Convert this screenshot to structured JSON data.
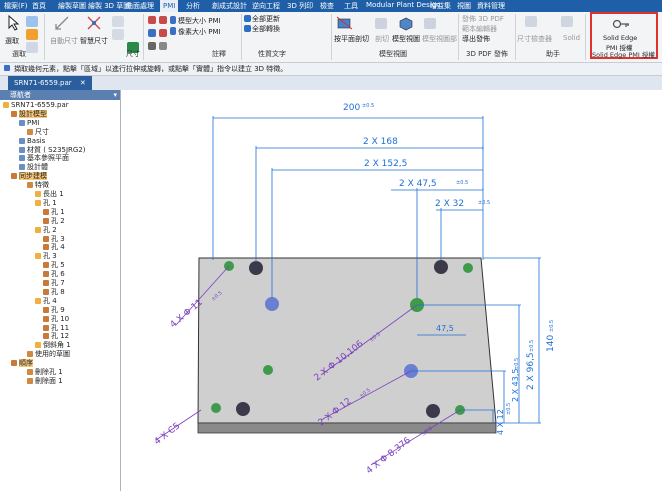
{
  "menu": {
    "items": [
      "檔案(F)",
      "首頁",
      "繪製草圖",
      "繪製 3D 草圖",
      "曲面處理",
      "PMI",
      "分析",
      "創成式設計",
      "逆向工程",
      "3D 列印",
      "檢查",
      "工具",
      "Modular Plant Design",
      "增益集",
      "視圖",
      "資料管理"
    ],
    "active": "PMI"
  },
  "ribbon": {
    "select_label": "選取",
    "auto_dim_label": "自動尺寸",
    "smart_dim_label": "智慧尺寸",
    "dim_group": "尺寸",
    "select_group": "選取",
    "model_size_pmi": "模型大小 PMI",
    "pixel_size_pmi": "像素大小 PMI",
    "annotate_group": "註釋",
    "update_all": "全部更新",
    "convert_all": "全部轉換",
    "props_group": "性質文字",
    "section_btn": "按平面剖切",
    "section_short": "剖切",
    "model_view_btn": "模型視圖",
    "model_view_sub": "模型視圖部",
    "model_view_group": "模型視圖",
    "publish_3dpdf": "發佈 3D PDF",
    "template_edit": "範本編輯器",
    "export_publish": "導出發佈",
    "pdf_group": "3D PDF 發佈",
    "dim_check": "尺寸檢查器",
    "solid_label": "Solid",
    "assistant_group": "助手",
    "se_pmi_line1": "Solid Edge",
    "se_pmi_line2": "PMI 授權",
    "se_pmi_group": "Solid Edge PMI 授權"
  },
  "prompt": "擷取幾何元素，點擊「區域」以進行拉伸或旋轉，或點擊「實體」指令以建立 3D 特徵。",
  "document_tab": "SRN71-6559.par",
  "navigator": {
    "title": "導航者",
    "items": [
      {
        "label": "SRN71-6559.par",
        "indent": 0,
        "hl": false
      },
      {
        "label": "設計模型",
        "indent": 1,
        "hl": true
      },
      {
        "label": "PMI",
        "indent": 2,
        "hl": false
      },
      {
        "label": "尺寸",
        "indent": 3,
        "hl": false
      },
      {
        "label": "Basis",
        "indent": 2,
        "hl": false
      },
      {
        "label": "材質 ( S235JRG2)",
        "indent": 2,
        "hl": false
      },
      {
        "label": "基本參照平面",
        "indent": 2,
        "hl": false
      },
      {
        "label": "設計體",
        "indent": 2,
        "hl": false
      },
      {
        "label": "同步建模",
        "indent": 1,
        "hl": true
      },
      {
        "label": "特徵",
        "indent": 3,
        "hl": false
      },
      {
        "label": "長出 1",
        "indent": 4,
        "hl": false
      },
      {
        "label": "孔 1",
        "indent": 4,
        "hl": false
      },
      {
        "label": "孔 1",
        "indent": 5,
        "hl": false
      },
      {
        "label": "孔 2",
        "indent": 5,
        "hl": false
      },
      {
        "label": "孔 2",
        "indent": 4,
        "hl": false
      },
      {
        "label": "孔 3",
        "indent": 5,
        "hl": false
      },
      {
        "label": "孔 4",
        "indent": 5,
        "hl": false
      },
      {
        "label": "孔 3",
        "indent": 4,
        "hl": false
      },
      {
        "label": "孔 5",
        "indent": 5,
        "hl": false
      },
      {
        "label": "孔 6",
        "indent": 5,
        "hl": false
      },
      {
        "label": "孔 7",
        "indent": 5,
        "hl": false
      },
      {
        "label": "孔 8",
        "indent": 5,
        "hl": false
      },
      {
        "label": "孔 4",
        "indent": 4,
        "hl": false
      },
      {
        "label": "孔 9",
        "indent": 5,
        "hl": false
      },
      {
        "label": "孔 10",
        "indent": 5,
        "hl": false
      },
      {
        "label": "孔 11",
        "indent": 5,
        "hl": false
      },
      {
        "label": "孔 12",
        "indent": 5,
        "hl": false
      },
      {
        "label": "倒斜角 1",
        "indent": 4,
        "hl": false
      },
      {
        "label": "使用的草圖",
        "indent": 3,
        "hl": false
      },
      {
        "label": "順序",
        "indent": 1,
        "hl": true
      },
      {
        "label": "刪除孔 1",
        "indent": 3,
        "hl": false
      },
      {
        "label": "刪除面 1",
        "indent": 3,
        "hl": false
      }
    ]
  },
  "dimensions": {
    "d200": "200",
    "d200_tol": "±0.5",
    "d168": "2 X  168",
    "d1525": "2 X  152,5",
    "d475a": "2 X  47,5",
    "d475a_tol": "±0.5",
    "d32": "2 X  32",
    "d32_tol": "±0.5",
    "d475b": "47,5",
    "d140": "140",
    "d140_tol": "±0.5",
    "d965": "2 X  96,5",
    "d965_tol": "±0.5",
    "d435": "2 X  43,5",
    "d435_tol": "±0.5",
    "d12": "4 X  12",
    "d12_tol": "±0.5",
    "phi11": "4 X  Φ 11",
    "phi11_tol": "±0.5",
    "phi10106": "2 X  Φ 10,106",
    "phi10106_tol": "±0.5",
    "phi12": "2 X  Φ 12",
    "phi12_tol": "±0.5",
    "phi8376": "4 X  Φ 8,376",
    "phi8376_tol": "±0.5",
    "c5": "4 X  C5"
  },
  "colors": {
    "menu_bg": "#1f5fa8",
    "dim_blue": "#1d6fd6",
    "dim_purple": "#7b3fbf",
    "highlight": "#f7c77a",
    "callout_red": "#e03030"
  }
}
